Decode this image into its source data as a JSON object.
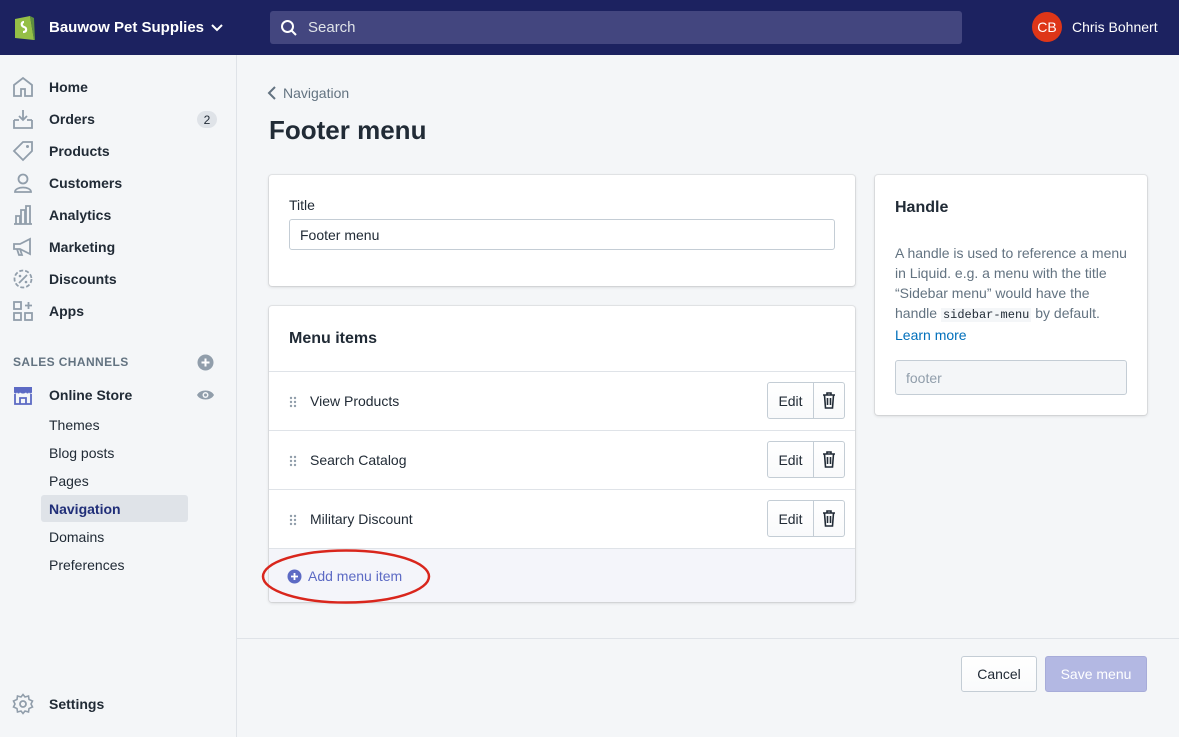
{
  "topbar": {
    "store_name": "Bauwow Pet Supplies",
    "search_placeholder": "Search",
    "user_initials": "CB",
    "user_name": "Chris Bohnert"
  },
  "sidebar": {
    "items": [
      {
        "label": "Home",
        "icon": "home-icon"
      },
      {
        "label": "Orders",
        "icon": "orders-icon",
        "badge": "2"
      },
      {
        "label": "Products",
        "icon": "tag-icon"
      },
      {
        "label": "Customers",
        "icon": "person-icon"
      },
      {
        "label": "Analytics",
        "icon": "bar-chart-icon"
      },
      {
        "label": "Marketing",
        "icon": "megaphone-icon"
      },
      {
        "label": "Discounts",
        "icon": "discount-icon"
      },
      {
        "label": "Apps",
        "icon": "apps-icon"
      }
    ],
    "sales_channels_title": "SALES CHANNELS",
    "online_store": "Online Store",
    "sub_items": [
      "Themes",
      "Blog posts",
      "Pages",
      "Navigation",
      "Domains",
      "Preferences"
    ],
    "active_sub_item": "Navigation",
    "settings": "Settings"
  },
  "page": {
    "breadcrumb": "Navigation",
    "title": "Footer menu"
  },
  "title_card": {
    "label": "Title",
    "value": "Footer menu"
  },
  "menu_card": {
    "heading": "Menu items",
    "items": [
      "View Products",
      "Search Catalog",
      "Military Discount"
    ],
    "edit_label": "Edit",
    "add_label": "Add menu item"
  },
  "handle_card": {
    "title": "Handle",
    "desc_before": "A handle is used to reference a menu in Liquid. e.g. a menu with the title “Sidebar menu” would have the handle ",
    "desc_code": "sidebar-menu",
    "desc_after": " by default.",
    "learn_more": "Learn more",
    "value": "footer"
  },
  "footer": {
    "cancel": "Cancel",
    "save": "Save menu"
  },
  "colors": {
    "topbar": "#1c2260",
    "accent": "#5c6ac4",
    "annotation": "#d9261c",
    "avatar": "#de3618"
  }
}
